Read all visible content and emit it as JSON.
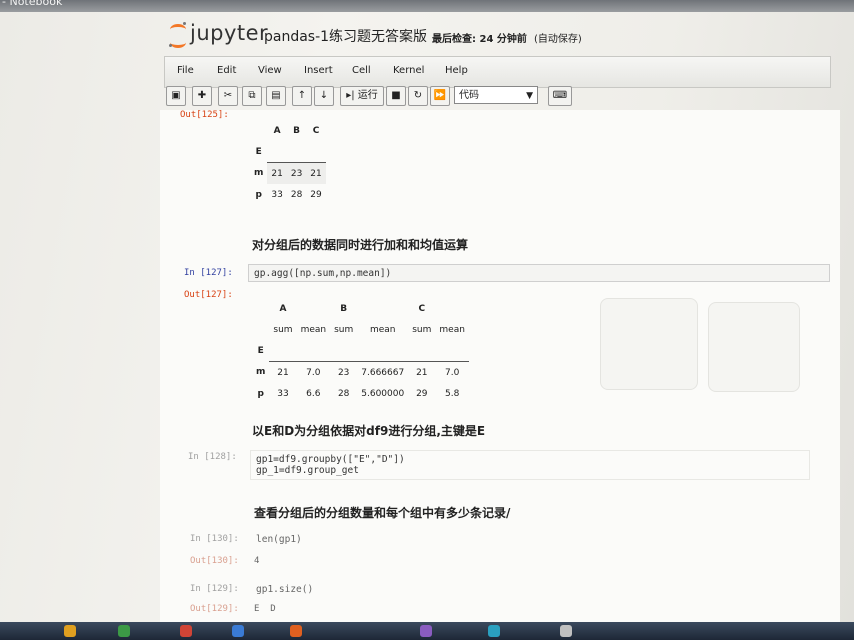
{
  "browser": {
    "tab_title": "- Notebook"
  },
  "header": {
    "brand": "jupyter",
    "notebook_title": "pandas-1练习题无答案版",
    "checkpoint": "最后检查: 24 分钟前",
    "autosave": "(自动保存)"
  },
  "menu": [
    "File",
    "Edit",
    "View",
    "Insert",
    "Cell",
    "Kernel",
    "Help"
  ],
  "toolbar": {
    "run_label": "运行",
    "cell_type": "代码",
    "icons": [
      "save-icon",
      "plus-icon",
      "cut-icon",
      "copy-icon",
      "paste-icon",
      "arrow-up-icon",
      "arrow-down-icon",
      "run-icon",
      "stop-icon",
      "restart-icon",
      "fast-forward-icon",
      "keyboard-icon"
    ]
  },
  "cells": {
    "out125": {
      "prompt": "Out[125]:",
      "columns": [
        "A",
        "B",
        "C"
      ],
      "index_name": "E",
      "rows": [
        {
          "index": "m",
          "values": [
            "21",
            "23",
            "21"
          ]
        },
        {
          "index": "p",
          "values": [
            "33",
            "28",
            "29"
          ]
        }
      ]
    },
    "md1": "对分组后的数据同时进行加和和均值运算",
    "in127": {
      "prompt": "In [127]:",
      "code": "gp.agg([np.sum,np.mean])"
    },
    "out127": {
      "prompt": "Out[127]:",
      "groups": [
        "A",
        "B",
        "C"
      ],
      "subcolumns": [
        "sum",
        "mean",
        "sum",
        "mean",
        "sum",
        "mean"
      ],
      "index_name": "E",
      "rows": [
        {
          "index": "m",
          "values": [
            "21",
            "7.0",
            "23",
            "7.666667",
            "21",
            "7.0"
          ]
        },
        {
          "index": "p",
          "values": [
            "33",
            "6.6",
            "28",
            "5.600000",
            "29",
            "5.8"
          ]
        }
      ]
    },
    "md2": "以E和D为分组依据对df9进行分组,主键是E",
    "in128": {
      "prompt": "In [128]:",
      "code": "gp1=df9.groupby([\"E\",\"D\"])\ngp_1=df9.group_get"
    },
    "md3": "查看分组后的分组数量和每个组中有多少条记录/",
    "in130": {
      "prompt": "In [130]:",
      "code": "len(gp1)"
    },
    "out130": {
      "prompt": "Out[130]:",
      "value": "4"
    },
    "in129": {
      "prompt": "In [129]:",
      "code": "gp1.size()"
    },
    "out129": {
      "prompt": "Out[129]:",
      "value": "E  D"
    }
  }
}
